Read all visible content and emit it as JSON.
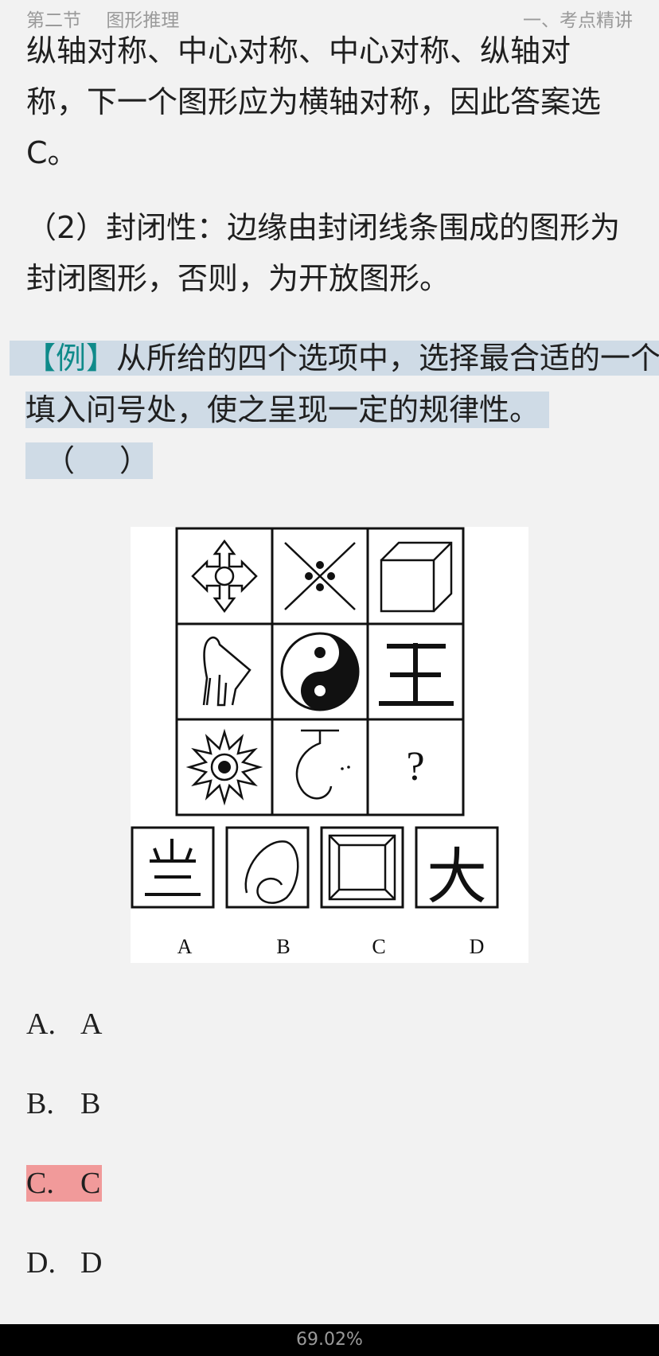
{
  "header": {
    "section": "第二节",
    "chapter": "图形推理",
    "right": "一、考点精讲"
  },
  "content": {
    "p1_lines": [
      "纵轴对称、中心对称、中心对称、纵轴对",
      "称，下一个图形应为横轴对称，因此答案选",
      "C。"
    ],
    "p2_lines": [
      "（2）封闭性：边缘由封闭线条围成的图形为",
      "封闭图形，否则，为开放图形。"
    ],
    "example": {
      "tag": "【例】",
      "line1_text": "从所给的四个选项中，选择最合适的一个",
      "line2": "填入问号处，使之呈现一定的规律性。",
      "paren_left": "（",
      "paren_right": "）"
    }
  },
  "figure": {
    "question_mark": "?",
    "option_labels": [
      "A",
      "B",
      "C",
      "D"
    ],
    "d_char": "大"
  },
  "options": [
    {
      "letter": "A.",
      "value": "A",
      "selected": false
    },
    {
      "letter": "B.",
      "value": "B",
      "selected": false
    },
    {
      "letter": "C.",
      "value": "C",
      "selected": true
    },
    {
      "letter": "D.",
      "value": "D",
      "selected": false
    }
  ],
  "footer": {
    "progress": "69.02%"
  }
}
